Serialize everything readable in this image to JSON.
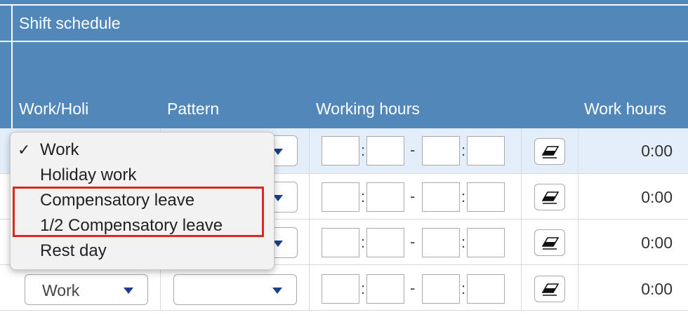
{
  "header": {
    "section_title": "Shift schedule",
    "columns": {
      "work_holi": "Work/Holi",
      "pattern": "Pattern",
      "working_hours": "Working hours",
      "work_hours": "Work hours"
    }
  },
  "rows": [
    {
      "work_type": "",
      "pattern": "",
      "hours": "0:00"
    },
    {
      "work_type": "",
      "pattern": "",
      "hours": "0:00"
    },
    {
      "work_type": "",
      "pattern": "",
      "hours": "0:00"
    },
    {
      "work_type": "Work",
      "pattern": "",
      "hours": "0:00"
    }
  ],
  "time_separators": {
    "colon": ":",
    "dash": "-"
  },
  "dropdown": {
    "checked_mark": "✓",
    "options": [
      "Work",
      "Holiday work",
      "Compensatory leave",
      "1/2 Compensatory leave",
      "Rest day"
    ],
    "selected": "Work"
  },
  "icons": {
    "dropdown_arrow": "chevron-down-icon",
    "clear": "eraser-icon"
  },
  "colors": {
    "header_bg": "#5287ba",
    "selected_row_bg": "#e3eefa",
    "highlight_border": "#e0271f"
  }
}
